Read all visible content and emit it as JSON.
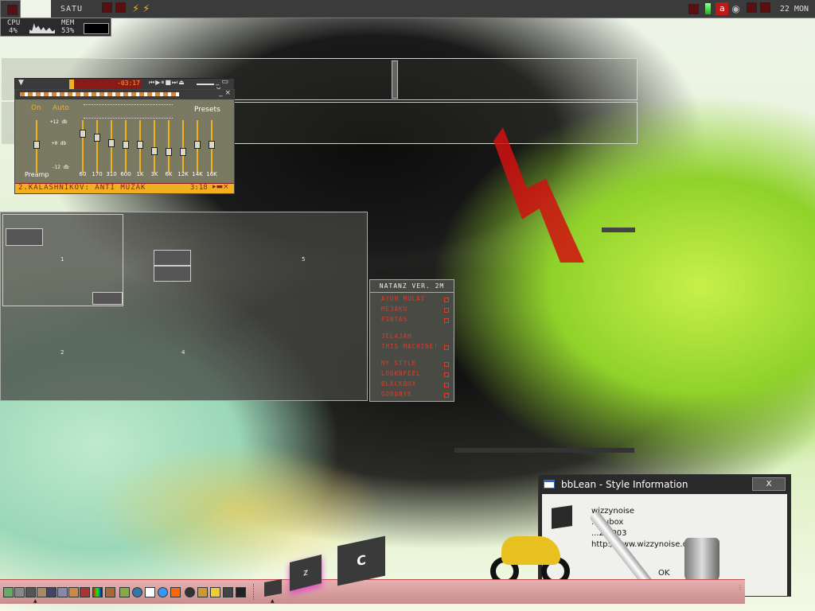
{
  "topbar": {
    "workspace": "SATU",
    "clock": "22 MON"
  },
  "stats": {
    "cpu_label": "CPU",
    "cpu_value": "4%",
    "mem_label": "MEM",
    "mem_value": "53%"
  },
  "player": {
    "time": "-03:17",
    "track": "2.KALASHNIKOV: ANTI MUZAK",
    "track_time": "3:18"
  },
  "equalizer": {
    "on_label": "On",
    "auto_label": "Auto",
    "presets_label": "Presets",
    "preamp_label": "Preamp",
    "db_top": "+12 db",
    "db_mid": "+0 db",
    "db_bot": "-12 db",
    "bands": [
      "60",
      "170",
      "310",
      "600",
      "1K",
      "3K",
      "6K",
      "12K",
      "14K",
      "16K"
    ]
  },
  "pager": {
    "ws1": "1",
    "ws2": "2",
    "ws4": "4",
    "ws5": "5"
  },
  "menu": {
    "title": "NATANZ VER. 2M",
    "items": [
      "AYUH MULAI",
      "MEJAKU",
      "PINTAS",
      "JELAJAH",
      "THIS MACHINE!",
      "MY STYLE",
      "LOOKNFEEL",
      "BLACKBOX",
      "GOODBYE"
    ]
  },
  "dialog": {
    "title": "bbLean - Style Information",
    "close": "X",
    "line1": "wizzynoise",
    "line2": "...dubox",
    "line3": "...2.2003",
    "line4": "http://www.wizzynoise.org",
    "ok": "OK"
  },
  "colors": {
    "accent_red": "#d01010",
    "eq_gold": "#f0b020",
    "taskbar_pink": "#d9a0a0"
  }
}
